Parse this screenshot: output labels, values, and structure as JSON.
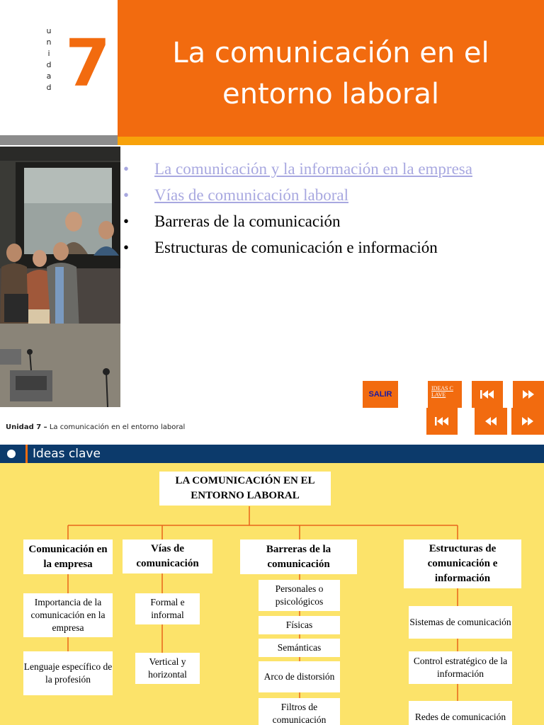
{
  "slide1": {
    "unit_word_letters": [
      "u",
      "n",
      "i",
      "d",
      "a",
      "d"
    ],
    "unit_number": "7",
    "title": "La comunicación en el entorno laboral",
    "photo": "photo-videoconference-meeting",
    "topics": [
      {
        "text": "La comunicación y la información en la empresa",
        "style": "link"
      },
      {
        "text": "Vías de comunicación laboral",
        "style": "link"
      },
      {
        "text": "Barreras de la comunicación",
        "style": "plain"
      },
      {
        "text": "Estructuras de comunicación e información",
        "style": "plain"
      }
    ],
    "bullet": "•",
    "nav": {
      "salir": "SALIR",
      "ideas_clave": "IDEAS C LAVE",
      "icons": [
        "skip-back-icon",
        "fast-forward-icon",
        "skip-back-icon",
        "rewind-icon",
        "fast-forward-icon"
      ]
    },
    "footer": {
      "unit_label": "Unidad 7 –",
      "text": "La comunicación en el entorno laboral"
    }
  },
  "slide2": {
    "header": "Ideas clave",
    "root": "LA COMUNICACIÓN EN EL ENTORNO LABORAL",
    "categories": [
      {
        "title": "Comunicación en la empresa",
        "items": [
          "Importancia de la comunicación en la empresa",
          "Lenguaje específico de la profesión"
        ]
      },
      {
        "title": "Vías de comunicación",
        "items": [
          "Formal e informal",
          "Vertical y horizontal"
        ]
      },
      {
        "title": "Barreras de la comunicación",
        "items": [
          "Personales o psicológicos",
          "Físicas",
          "Semánticas",
          "Arco de distorsión",
          "Filtros de comunicación"
        ]
      },
      {
        "title": "Estructuras de comunicación e información",
        "items": [
          "Sistemas de comunicación",
          "Control estratégico de la información",
          "Redes de comunicación"
        ]
      }
    ]
  },
  "colors": {
    "orange": "#f26b0f",
    "amber": "#f8a20a",
    "navy": "#0c3a6b",
    "yellow_bg": "#fce36a",
    "link": "#a8a8e0"
  }
}
